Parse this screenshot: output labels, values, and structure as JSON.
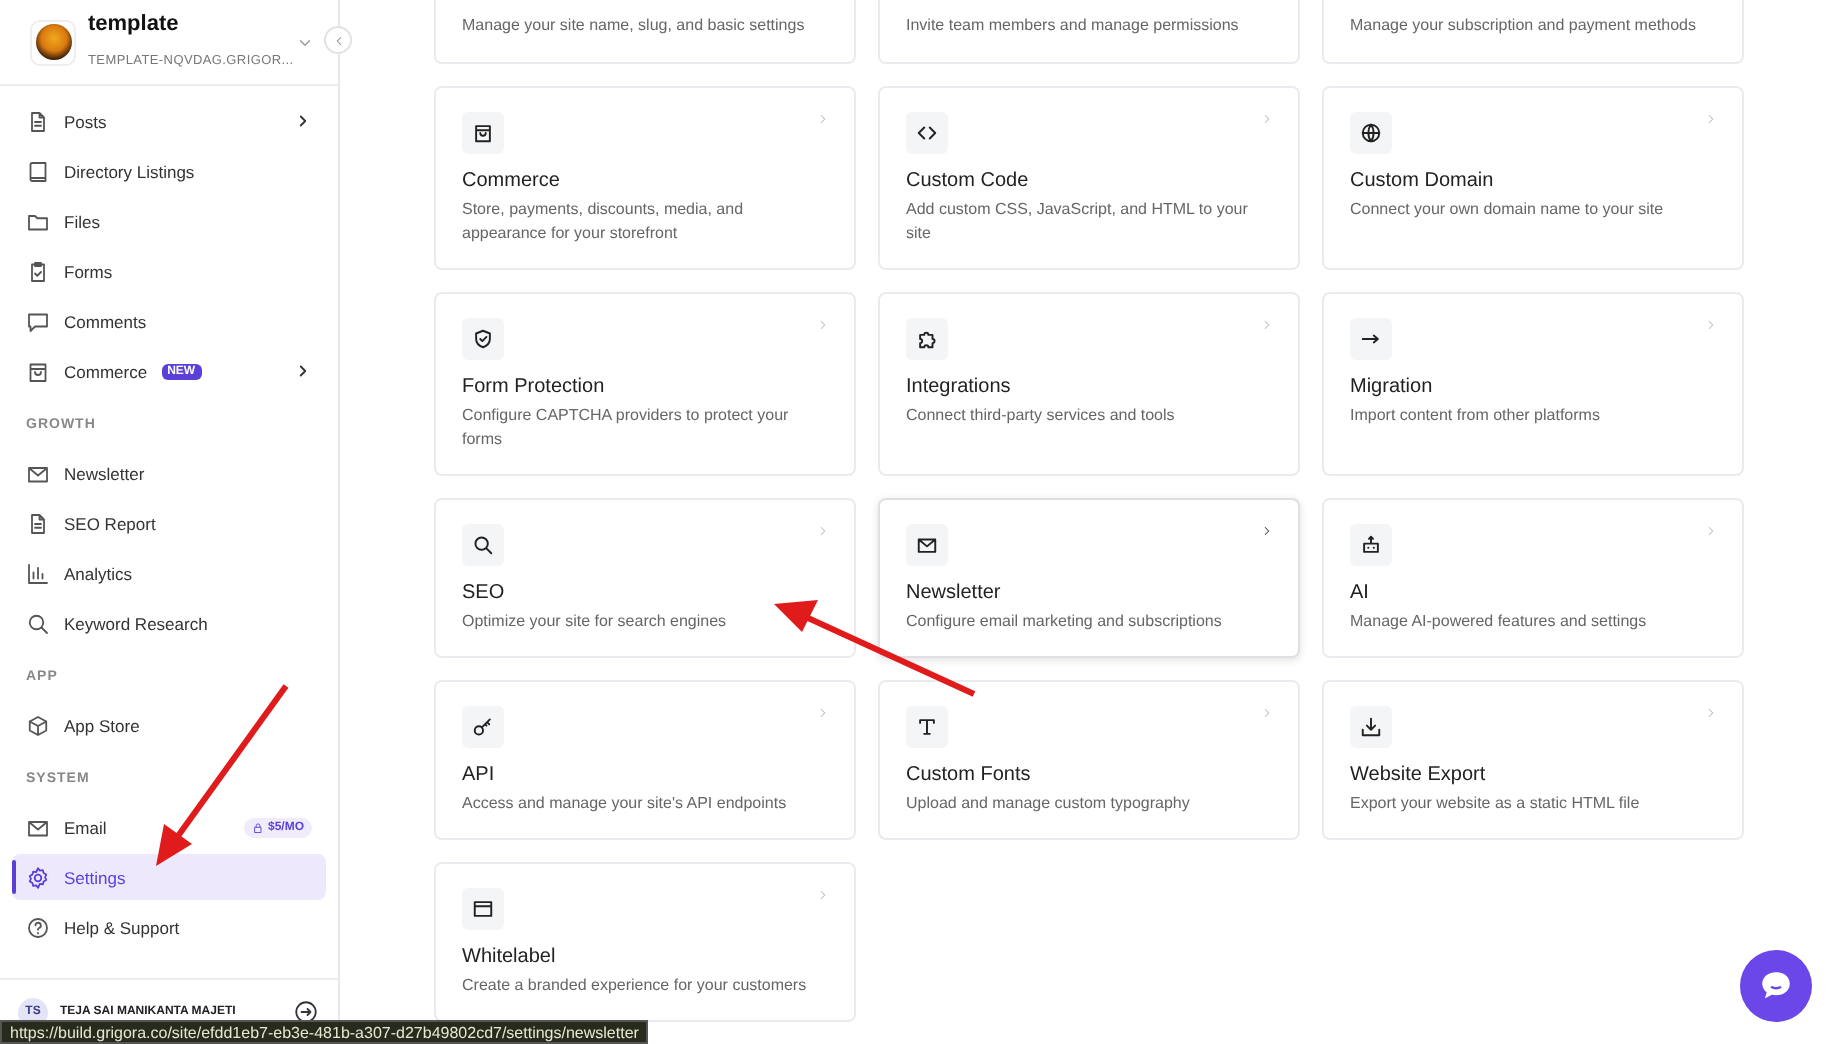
{
  "sidebar": {
    "site": {
      "name": "template",
      "subdomain": "TEMPLATE-NQVDAG.GRIGOR..."
    },
    "sections": [
      {
        "items": [
          {
            "label": "Posts",
            "selected": false,
            "expandable": true
          },
          {
            "label": "Directory Listings",
            "selected": false,
            "expandable": false
          },
          {
            "label": "Files",
            "selected": false,
            "expandable": false
          },
          {
            "label": "Forms",
            "selected": false,
            "expandable": false
          },
          {
            "label": "Comments",
            "selected": false,
            "expandable": false
          },
          {
            "label": "Commerce",
            "selected": false,
            "expandable": true,
            "badge": "NEW"
          }
        ]
      },
      {
        "heading": "GROWTH",
        "items": [
          {
            "label": "Newsletter",
            "selected": false,
            "expandable": false
          },
          {
            "label": "SEO Report",
            "selected": false,
            "expandable": false
          },
          {
            "label": "Analytics",
            "selected": false,
            "expandable": false
          },
          {
            "label": "Keyword Research",
            "selected": false,
            "expandable": false
          }
        ]
      },
      {
        "heading": "APP",
        "items": [
          {
            "label": "App Store",
            "selected": false,
            "expandable": false
          }
        ]
      },
      {
        "heading": "SYSTEM",
        "items": [
          {
            "label": "Email",
            "selected": false,
            "expandable": false,
            "price": "$5/MO"
          },
          {
            "label": "Settings",
            "selected": true,
            "expandable": false
          },
          {
            "label": "Help & Support",
            "selected": false,
            "expandable": false
          }
        ]
      }
    ],
    "user": {
      "initials": "TS",
      "name": "TEJA SAI MANIKANTA MAJETI"
    }
  },
  "cards": [
    {
      "kind": "cut",
      "description": "Manage your site name, slug, and basic settings",
      "hovered": false
    },
    {
      "kind": "cut",
      "description": "Invite team members and manage permissions",
      "hovered": false
    },
    {
      "kind": "cut",
      "description": "Manage your subscription and payment methods",
      "hovered": false
    },
    {
      "kind": "full",
      "title": "Commerce",
      "description": "Store, payments, discounts, media, and appearance for your storefront",
      "hovered": false
    },
    {
      "kind": "full",
      "title": "Custom Code",
      "description": "Add custom CSS, JavaScript, and HTML to your site",
      "hovered": false
    },
    {
      "kind": "full",
      "title": "Custom Domain",
      "description": "Connect your own domain name to your site",
      "hovered": false
    },
    {
      "kind": "full",
      "title": "Form Protection",
      "description": "Configure CAPTCHA providers to protect your forms",
      "hovered": false
    },
    {
      "kind": "full",
      "title": "Integrations",
      "description": "Connect third-party services and tools",
      "hovered": false
    },
    {
      "kind": "full",
      "title": "Migration",
      "description": "Import content from other platforms",
      "hovered": false
    },
    {
      "kind": "full",
      "title": "SEO",
      "description": "Optimize your site for search engines",
      "hovered": false
    },
    {
      "kind": "full",
      "title": "Newsletter",
      "description": "Configure email marketing and subscriptions",
      "hovered": true
    },
    {
      "kind": "full",
      "title": "AI",
      "description": "Manage AI-powered features and settings",
      "hovered": false
    },
    {
      "kind": "full",
      "title": "API",
      "description": "Access and manage your site's API endpoints",
      "hovered": false
    },
    {
      "kind": "full",
      "title": "Custom Fonts",
      "description": "Upload and manage custom typography",
      "hovered": false
    },
    {
      "kind": "full",
      "title": "Website Export",
      "description": "Export your website as a static HTML file",
      "hovered": false
    },
    {
      "kind": "full",
      "title": "Whitelabel",
      "description": "Create a branded experience for your customers",
      "hovered": false
    }
  ],
  "status_url": "https://build.grigora.co/site/efdd1eb7-eb3e-481b-a307-d27b49802cd7/settings/newsletter"
}
